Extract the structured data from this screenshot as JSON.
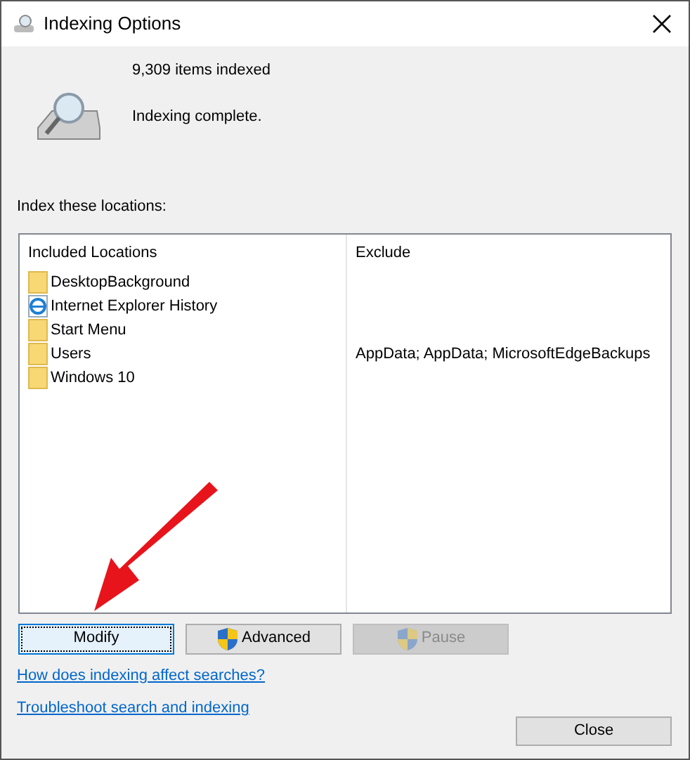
{
  "window": {
    "title": "Indexing Options"
  },
  "status": {
    "count": "9,309 items indexed",
    "message": "Indexing complete."
  },
  "locations_label": "Index these locations:",
  "table": {
    "columns": [
      "Included Locations",
      "Exclude"
    ],
    "rows": [
      {
        "kind": "folder",
        "location": "DesktopBackground"
      },
      {
        "kind": "browser",
        "location": "Internet Explorer History"
      },
      {
        "kind": "folder",
        "location": "Start Menu"
      },
      {
        "kind": "folder",
        "location": "Users",
        "exclude": "AppData; AppData; MicrosoftEdgeBackups"
      },
      {
        "kind": "folder",
        "location": "Windows 10"
      }
    ]
  },
  "buttons": [
    {
      "label": "Modify",
      "shield": false,
      "focused": true,
      "disabled": false
    },
    {
      "label": "Advanced",
      "shield": true,
      "focused": false,
      "disabled": false
    },
    {
      "label": "Pause",
      "shield": true,
      "focused": false,
      "disabled": true
    }
  ],
  "links": [
    "How does indexing affect searches?",
    "Troubleshoot search and indexing"
  ],
  "close_button": "Close"
}
